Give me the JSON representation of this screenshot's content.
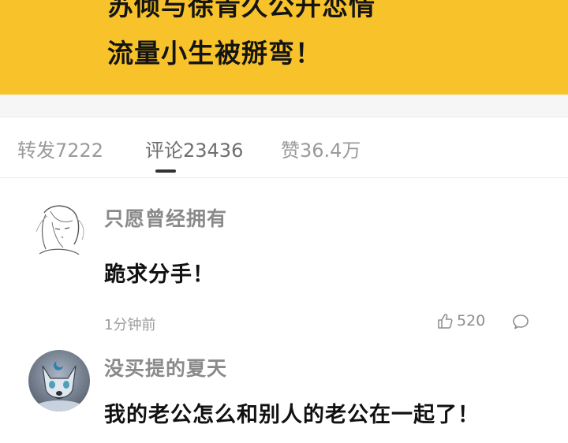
{
  "headline": {
    "line1": "苏倾与徐青久公开恋情",
    "line2": "流量小生被掰弯！"
  },
  "tabs": [
    {
      "label": "转发7222"
    },
    {
      "label": "评论23436",
      "active": true
    },
    {
      "label": "赞36.4万"
    }
  ],
  "comments": [
    {
      "username": "只愿曾经拥有",
      "text": "跪求分手！",
      "time": "1分钟前",
      "likes": "520",
      "avatar_icon": "sketch-portrait-avatar"
    },
    {
      "username": "没买提的夏天",
      "text": "我的老公怎么和别人的老公在一起了！",
      "avatar_icon": "fox-character-avatar"
    }
  ],
  "colors": {
    "banner": "#f8c32a",
    "username": "#8a8a8a",
    "text": "#111111",
    "meta": "#9d9d9d"
  }
}
